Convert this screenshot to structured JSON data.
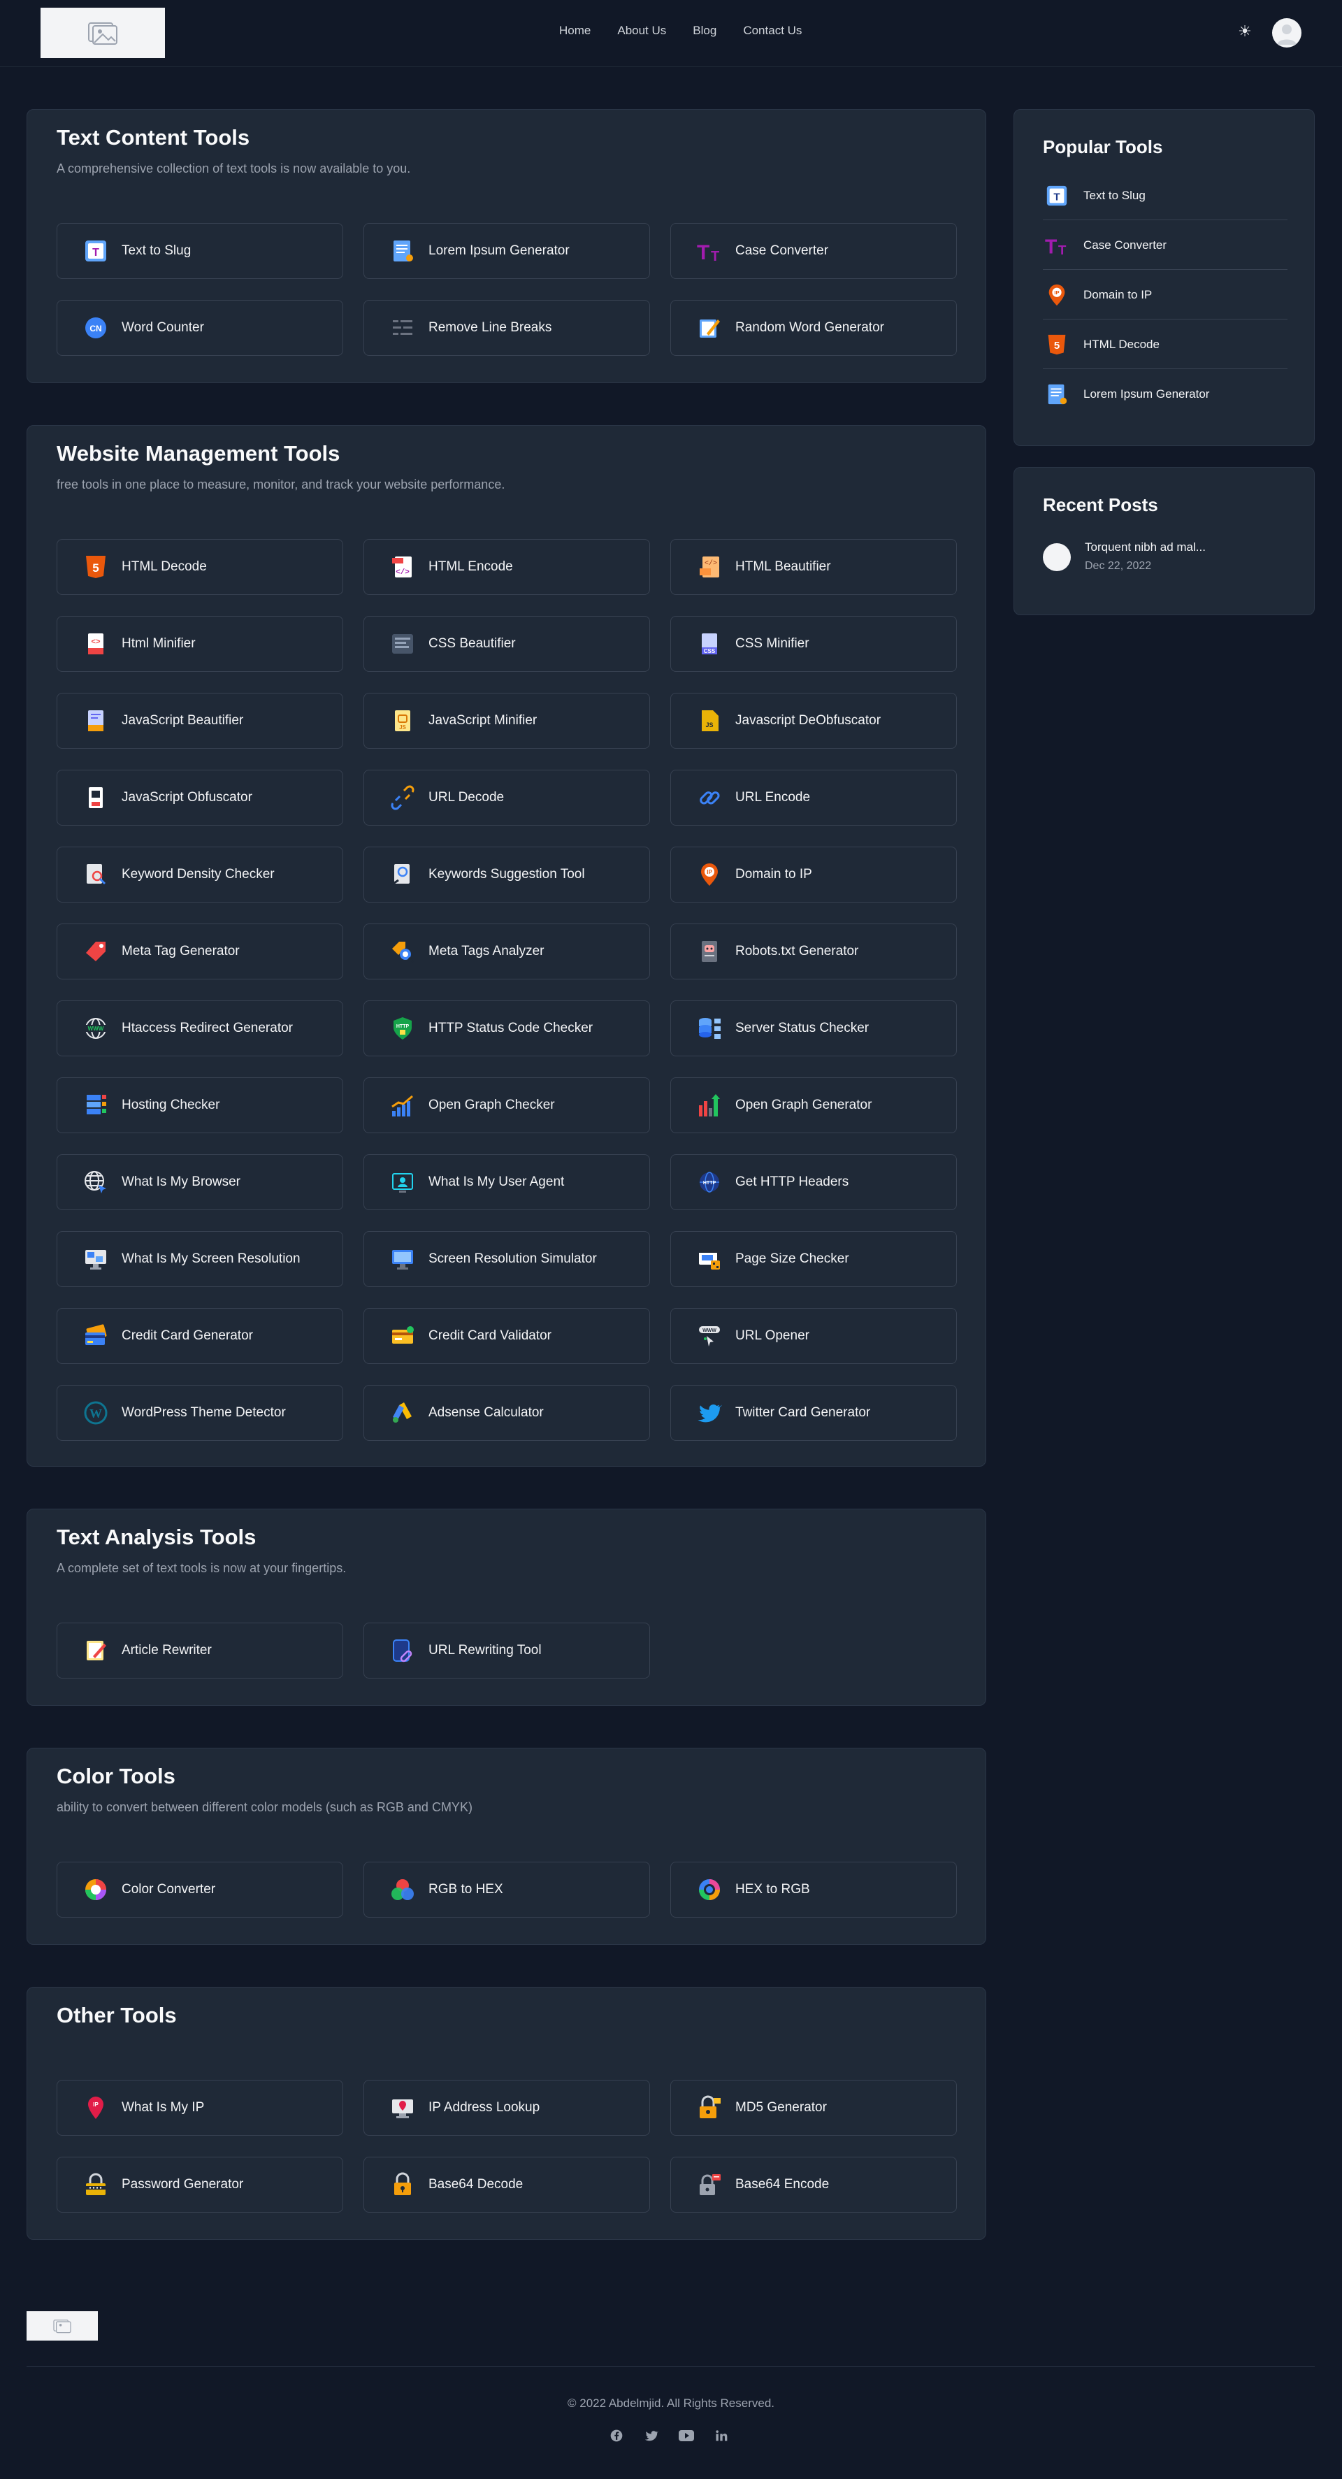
{
  "nav": {
    "home": "Home",
    "about": "About Us",
    "blog": "Blog",
    "contact": "Contact Us"
  },
  "theme_toggle_icon": "☀",
  "sections": {
    "text_content": {
      "title": "Text Content Tools",
      "desc": "A comprehensive collection of text tools is now available to you.",
      "tools": [
        "Text to Slug",
        "Lorem Ipsum Generator",
        "Case Converter",
        "Word Counter",
        "Remove Line Breaks",
        "Random Word Generator"
      ]
    },
    "website": {
      "title": "Website Management Tools",
      "desc": "free tools in one place to measure, monitor, and track your website performance.",
      "tools": [
        "HTML Decode",
        "HTML Encode",
        "HTML Beautifier",
        "Html Minifier",
        "CSS Beautifier",
        "CSS Minifier",
        "JavaScript Beautifier",
        "JavaScript Minifier",
        "Javascript DeObfuscator",
        "JavaScript Obfuscator",
        "URL Decode",
        "URL Encode",
        "Keyword Density Checker",
        "Keywords Suggestion Tool",
        "Domain to IP",
        "Meta Tag Generator",
        "Meta Tags Analyzer",
        "Robots.txt Generator",
        "Htaccess Redirect Generator",
        "HTTP Status Code Checker",
        "Server Status Checker",
        "Hosting Checker",
        "Open Graph Checker",
        "Open Graph Generator",
        "What Is My Browser",
        "What Is My User Agent",
        "Get HTTP Headers",
        "What Is My Screen Resolution",
        "Screen Resolution Simulator",
        "Page Size Checker",
        "Credit Card Generator",
        "Credit Card Validator",
        "URL Opener",
        "WordPress Theme Detector",
        "Adsense Calculator",
        "Twitter Card Generator"
      ]
    },
    "text_analysis": {
      "title": "Text Analysis Tools",
      "desc": "A complete set of text tools is now at your fingertips.",
      "tools": [
        "Article Rewriter",
        "URL Rewriting Tool"
      ]
    },
    "color": {
      "title": "Color Tools",
      "desc": "ability to convert between different color models (such as RGB and CMYK)",
      "tools": [
        "Color Converter",
        "RGB to HEX",
        "HEX to RGB"
      ]
    },
    "other": {
      "title": "Other Tools",
      "tools": [
        "What Is My IP",
        "IP Address Lookup",
        "MD5 Generator",
        "Password Generator",
        "Base64 Decode",
        "Base64 Encode"
      ]
    }
  },
  "popular": {
    "title": "Popular Tools",
    "items": [
      "Text to Slug",
      "Case Converter",
      "Domain to IP",
      "HTML Decode",
      "Lorem Ipsum Generator"
    ]
  },
  "recent": {
    "title": "Recent Posts",
    "post_title": "Torquent nibh ad mal...",
    "post_date": "Dec 22, 2022"
  },
  "footer": {
    "copyright": "© 2022 Abdelmjid. All Rights Reserved."
  },
  "icon_names": {
    "social": [
      "facebook-icon",
      "twitter-icon",
      "youtube-icon",
      "linkedin-icon"
    ]
  }
}
